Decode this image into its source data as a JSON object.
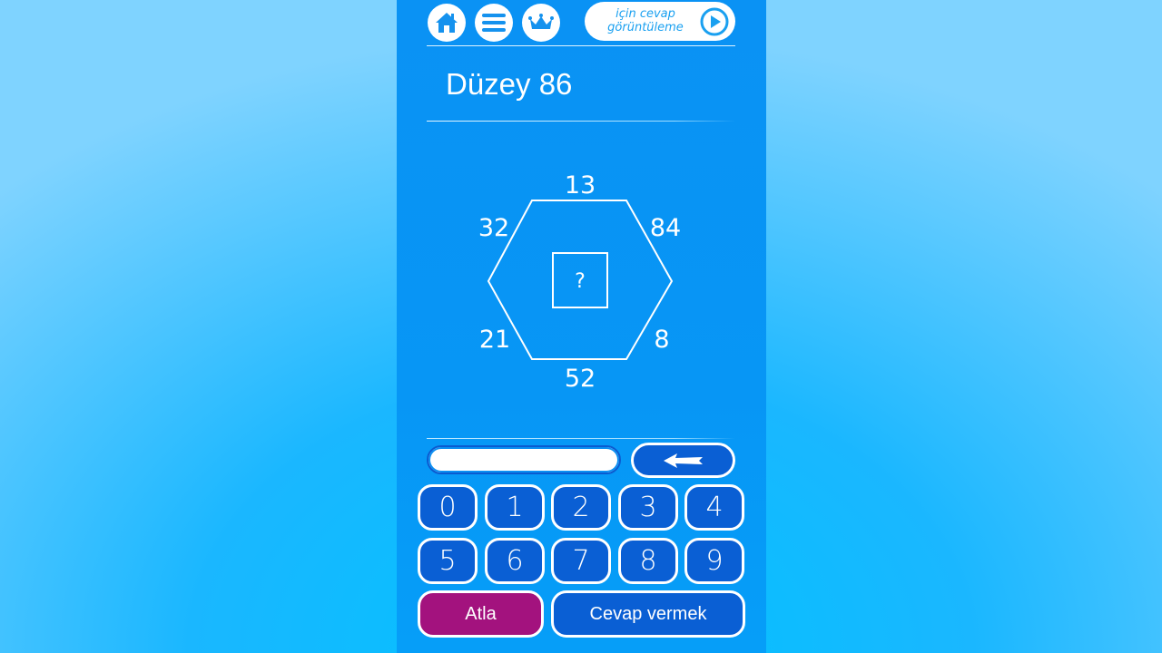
{
  "header": {
    "buttons": [
      {
        "icon": "home-icon"
      },
      {
        "icon": "menu-icon"
      },
      {
        "icon": "crown-icon"
      }
    ],
    "answer_button": {
      "line1": "için cevap",
      "line2": "görüntüleme",
      "icon": "play-icon"
    }
  },
  "level": {
    "title": "Düzey 86"
  },
  "puzzle": {
    "shape": "hexagon",
    "top": "13",
    "upper_right": "84",
    "lower_right": "8",
    "bottom": "52",
    "lower_left": "21",
    "upper_left": "32",
    "center": "?"
  },
  "input": {
    "value": "",
    "backspace_icon": "arrow-left-icon"
  },
  "keypad": {
    "digits": [
      "0",
      "1",
      "2",
      "3",
      "4",
      "5",
      "6",
      "7",
      "8",
      "9"
    ]
  },
  "actions": {
    "skip_label": "Atla",
    "submit_label": "Cevap vermek"
  },
  "colors": {
    "panel": "#0796f5",
    "button_blue": "#0a5fd4",
    "skip_magenta": "#a3127e"
  }
}
